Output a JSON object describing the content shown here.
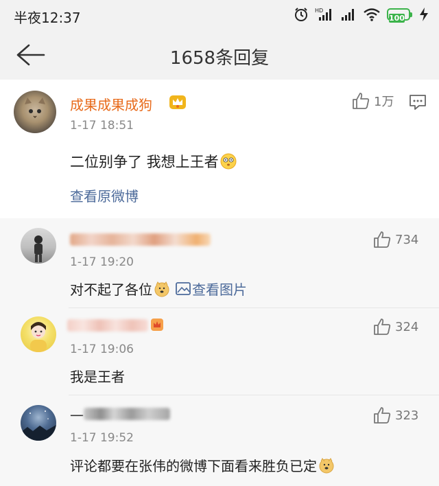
{
  "status": {
    "time": "半夜12:37",
    "battery": "100"
  },
  "header": {
    "title": "1658条回复"
  },
  "main_comment": {
    "user": "成果成果成狗",
    "time": "1-17 18:51",
    "likes": "1万",
    "text": "二位别争了 我想上王者",
    "view_original": "查看原微博"
  },
  "replies": [
    {
      "time": "1-17 19:20",
      "likes": "734",
      "text": "对不起了各位",
      "attachment": "查看图片"
    },
    {
      "time": "1-17 19:06",
      "likes": "324",
      "text": "我是王者"
    },
    {
      "name_prefix": "一",
      "time": "1-17 19:52",
      "likes": "323",
      "text": "评论都要在张伟的微博下面看来胜负已定"
    }
  ],
  "colors": {
    "username_orange": "#e86b1c",
    "link_blue": "#4c6a9a",
    "battery_green": "#3bb34a"
  }
}
